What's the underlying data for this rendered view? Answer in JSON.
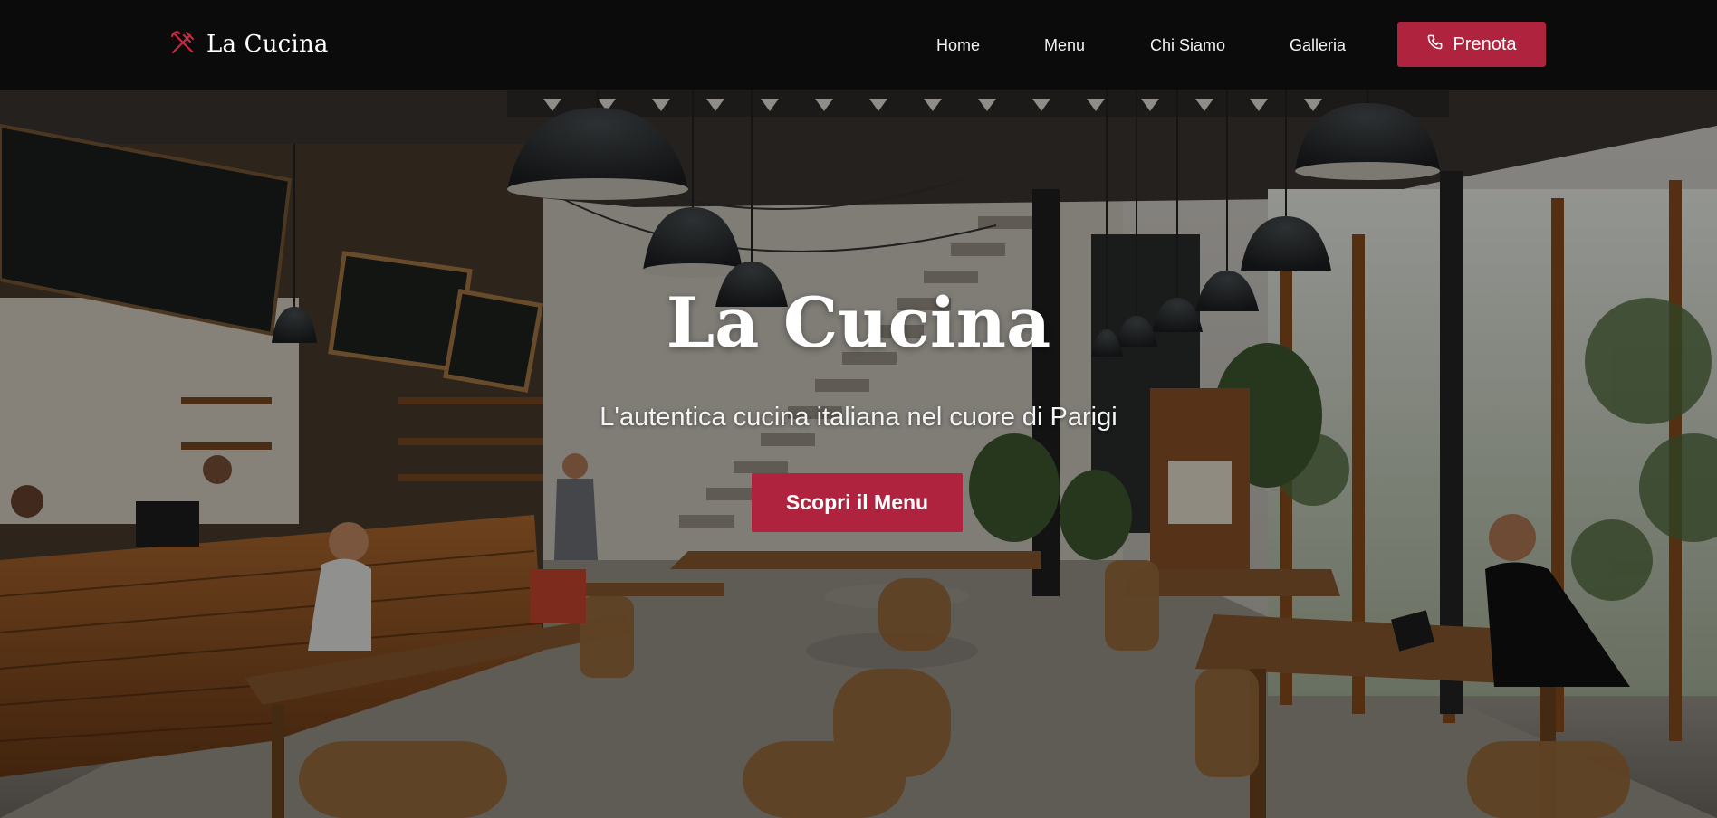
{
  "brand": {
    "name": "La Cucina",
    "logo_icon": "fork-knife-icon",
    "accent_color": "#b0233e"
  },
  "nav": {
    "items": [
      {
        "label": "Home"
      },
      {
        "label": "Menu"
      },
      {
        "label": "Chi Siamo"
      },
      {
        "label": "Galleria"
      }
    ],
    "cta": {
      "label": "Prenota",
      "icon": "phone-icon"
    }
  },
  "hero": {
    "title": "La Cucina",
    "subtitle": "L'autentica cucina italiana nel cuore di Parigi",
    "button_label": "Scopri il Menu",
    "background": "restaurant-interior-photo"
  }
}
